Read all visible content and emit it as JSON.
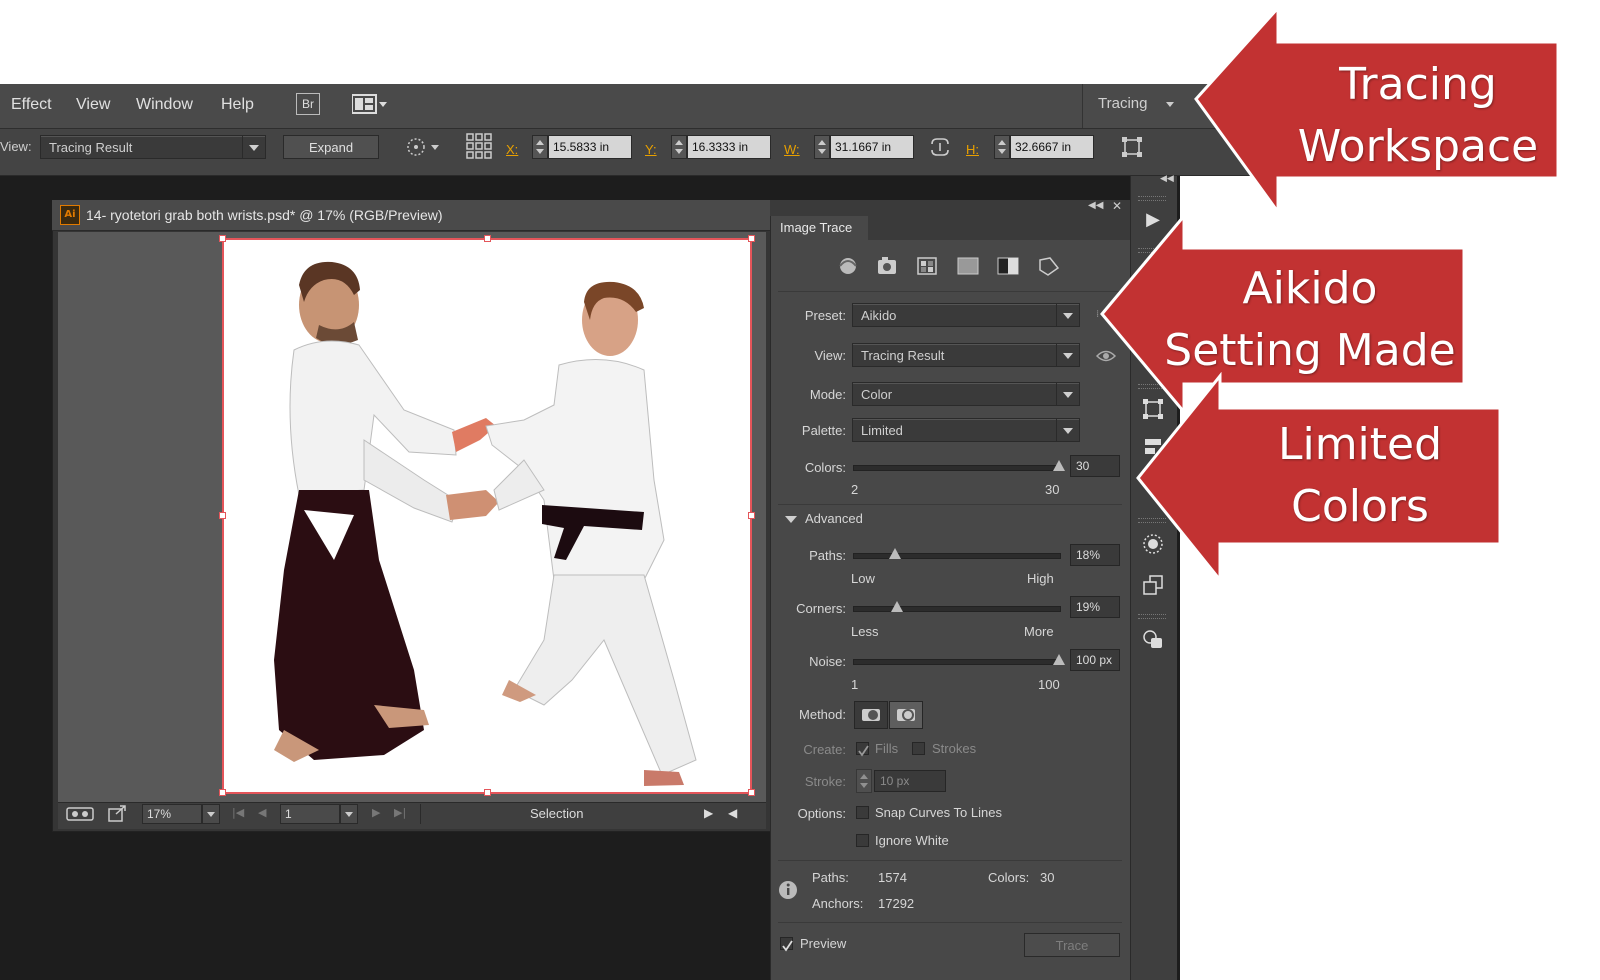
{
  "menu": [
    "Effect",
    "View",
    "Window",
    "Help"
  ],
  "menu_buttons": {
    "bridge": "Br"
  },
  "workspace_switcher": {
    "label": "Tracing"
  },
  "control": {
    "view_label": "View:",
    "view_value": "Tracing Result",
    "expand_label": "Expand",
    "x_label": "X:",
    "x_value": "15.5833 in",
    "y_label": "Y:",
    "y_value": "16.3333 in",
    "w_label": "W:",
    "w_value": "31.1667 in",
    "h_label": "H:",
    "h_value": "32.6667 in"
  },
  "document": {
    "app_badge": "Ai",
    "title": "14- ryotetori grab both wrists.psd* @ 17% (RGB/Preview)",
    "zoom": "17%",
    "artboard": "1",
    "status_tool": "Selection"
  },
  "panel": {
    "title": "Image Trace",
    "preset_label": "Preset:",
    "preset_value": "Aikido",
    "view_label": "View:",
    "view_value": "Tracing Result",
    "mode_label": "Mode:",
    "mode_value": "Color",
    "palette_label": "Palette:",
    "palette_value": "Limited",
    "colors_label": "Colors:",
    "colors_value": "30",
    "colors_min": "2",
    "colors_max": "30",
    "advanced_label": "Advanced",
    "paths_label": "Paths:",
    "paths_value": "18%",
    "paths_low": "Low",
    "paths_high": "High",
    "corners_label": "Corners:",
    "corners_value": "19%",
    "corners_less": "Less",
    "corners_more": "More",
    "noise_label": "Noise:",
    "noise_value": "100 px",
    "noise_min": "1",
    "noise_max": "100",
    "method_label": "Method:",
    "create_label": "Create:",
    "fills_label": "Fills",
    "strokes_label": "Strokes",
    "stroke_label": "Stroke:",
    "stroke_value": "10 px",
    "options_label": "Options:",
    "snap_label": "Snap Curves To Lines",
    "ignore_white_label": "Ignore White",
    "info_paths_label": "Paths:",
    "info_paths_value": "1574",
    "info_colors_label": "Colors:",
    "info_colors_value": "30",
    "info_anchors_label": "Anchors:",
    "info_anchors_value": "17292",
    "preview_label": "Preview",
    "trace_label": "Trace",
    "sliders": {
      "colors": 1.0,
      "paths": 0.18,
      "corners": 0.19,
      "noise": 1.0
    }
  },
  "callouts": [
    {
      "line1": "Tracing",
      "line2": "Workspace"
    },
    {
      "line1": "Aikido",
      "line2": "Setting Made"
    },
    {
      "line1": "Limited",
      "line2": "Colors"
    }
  ],
  "colors": {
    "callout_red": "#c23232",
    "accent_orange": "#e8a000",
    "selection_red": "#e4555a"
  }
}
